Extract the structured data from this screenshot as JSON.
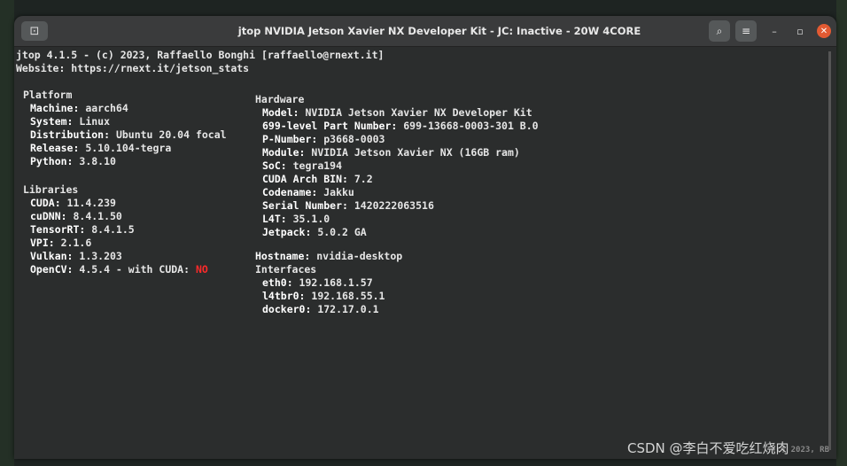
{
  "window": {
    "title": "jtop NVIDIA Jetson Xavier NX Developer Kit - JC: Inactive - 20W 4CORE",
    "controls": {
      "search_icon": "⌕",
      "menu_icon": "≡",
      "minimize": "–",
      "maximize": "▫",
      "close": "✕"
    }
  },
  "header": {
    "line1": "jtop 4.1.5 - (c) 2023, Raffaello Bonghi [raffaello@rnext.it]",
    "line2": "Website: https://rnext.it/jetson_stats"
  },
  "platform": {
    "heading": "Platform",
    "items": [
      {
        "key": "Machine:",
        "value": " aarch64"
      },
      {
        "key": "System:",
        "value": " Linux"
      },
      {
        "key": "Distribution:",
        "value": " Ubuntu 20.04 focal"
      },
      {
        "key": "Release:",
        "value": " 5.10.104-tegra"
      },
      {
        "key": "Python:",
        "value": " 3.8.10"
      }
    ]
  },
  "libraries": {
    "heading": "Libraries",
    "items": [
      {
        "key": "CUDA:",
        "value": " 11.4.239"
      },
      {
        "key": "cuDNN:",
        "value": " 8.4.1.50"
      },
      {
        "key": "TensorRT:",
        "value": " 8.4.1.5"
      },
      {
        "key": "VPI:",
        "value": " 2.1.6"
      },
      {
        "key": "Vulkan:",
        "value": " 1.3.203"
      }
    ],
    "opencv": {
      "key": "OpenCV:",
      "value": " 4.5.4 - with CUDA: ",
      "cuda_flag": "NO"
    }
  },
  "hardware": {
    "heading": "Hardware",
    "items": [
      {
        "key": "Model:",
        "value": " NVIDIA Jetson Xavier NX Developer Kit"
      },
      {
        "key": "699-level Part Number:",
        "value": " 699-13668-0003-301 B.0"
      },
      {
        "key": "P-Number:",
        "value": " p3668-0003"
      },
      {
        "key": "Module:",
        "value": " NVIDIA Jetson Xavier NX (16GB ram)"
      },
      {
        "key": "SoC:",
        "value": " tegra194"
      },
      {
        "key": "CUDA Arch BIN:",
        "value": " 7.2"
      },
      {
        "key": "Codename:",
        "value": " Jakku"
      },
      {
        "key": "Serial Number:",
        "value": " 1420222063516"
      },
      {
        "key": "L4T:",
        "value": " 35.1.0"
      },
      {
        "key": "Jetpack:",
        "value": " 5.0.2 GA"
      }
    ]
  },
  "network": {
    "hostname": {
      "key": "Hostname:",
      "value": " nvidia-desktop"
    },
    "interfaces_heading": "Interfaces",
    "interfaces": [
      {
        "key": "eth0:",
        "value": " 192.168.1.57"
      },
      {
        "key": "l4tbr0:",
        "value": " 192.168.55.1"
      },
      {
        "key": "docker0:",
        "value": " 172.17.0.1"
      }
    ]
  },
  "footer": {
    "corner_text": "(c) 2023, RB",
    "watermark": "CSDN @李白不爱吃红烧肉"
  }
}
